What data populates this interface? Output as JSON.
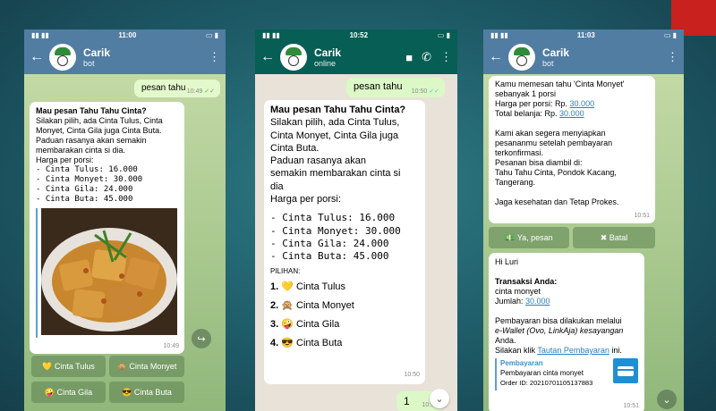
{
  "colors": {
    "telegram_header": "#517da2",
    "whatsapp_header": "#075e54",
    "outgoing_bubble": "#e3f9cc",
    "red_corner": "#c8211e"
  },
  "phone1": {
    "status_time": "11:00",
    "name": "Carik",
    "sub": "bot",
    "out_text": "pesan tahu",
    "out_time": "10:49",
    "in_title": "Mau pesan Tahu Tahu Cinta?",
    "in_body": [
      "Silakan pilih, ada Cinta Tulus, Cinta",
      "Monyet, Cinta Gila juga Cinta Buta.",
      "Paduan rasanya akan semakin",
      "membarakan cinta si dia.",
      "Harga per porsi:"
    ],
    "prices": [
      "- Cinta Tulus: 16.000",
      "- Cinta Monyet: 30.000",
      "- Cinta Gila: 24.000",
      "- Cinta Buta: 45.000"
    ],
    "in_time": "10:49",
    "buttons": [
      "💛 Cinta Tulus",
      "🙊 Cinta Monyet",
      "🤪 Cinta Gila",
      "😎 Cinta Buta"
    ]
  },
  "phone2": {
    "status_time": "10:52",
    "name": "Carik",
    "sub": "online",
    "out_text": "pesan tahu",
    "out_time": "10:50",
    "in_title": "Mau pesan Tahu Tahu Cinta?",
    "in_body": [
      "Silakan pilih, ada Cinta Tulus,",
      "Cinta Monyet, Cinta Gila juga",
      "Cinta Buta.",
      "Paduan rasanya akan",
      "semakin membarakan cinta si",
      "dia",
      "Harga per porsi:"
    ],
    "prices": [
      "- Cinta Tulus: 16.000",
      "- Cinta Monyet: 30.000",
      "- Cinta Gila: 24.000",
      "- Cinta Buta: 45.000"
    ],
    "pilihan_label": "PILIHAN:",
    "options": [
      {
        "num": "1.",
        "emoji": "💛",
        "label": "Cinta Tulus"
      },
      {
        "num": "2.",
        "emoji": "🙊",
        "label": "Cinta Monyet"
      },
      {
        "num": "3.",
        "emoji": "🤪",
        "label": "Cinta Gila"
      },
      {
        "num": "4.",
        "emoji": "😎",
        "label": "Cinta Buta"
      }
    ],
    "in_time": "10:50",
    "reply_text": "1",
    "reply_time": "10:51"
  },
  "phone3": {
    "status_time": "11:03",
    "name": "Carik",
    "sub": "bot",
    "msg1_lines": [
      "Kamu memesan tahu 'Cinta Monyet'",
      "sebanyak 1 porsi"
    ],
    "harga_label": "Harga per porsi: Rp. ",
    "harga_value": "30.000",
    "total_label": "Total belanja: Rp. ",
    "total_value": "30.000",
    "msg1_body": [
      "Kami akan segera menyiapkan",
      "pesananmu setelah pembayaran",
      "terkonfirmasi.",
      "Pesanan bisa diambil di:",
      "Tahu Tahu Cinta, Pondok Kacang,",
      "Tangerang."
    ],
    "msg1_footer": "Jaga kesehatan dan Tetap Prokes.",
    "msg1_time": "10:51",
    "btn_yes": "💵 Ya, pesan",
    "btn_no": "✖ Batal",
    "msg2_greet": "Hi Luri",
    "trans_label": "Transaksi Anda:",
    "trans_item": "cinta monyet",
    "jumlah_label": "Jumlah: ",
    "jumlah_value": "30.000",
    "pay_lines": [
      "Pembayaran bisa dilakukan melalui",
      "e-Wallet (Ovo, LinkAja) kesayangan",
      "Anda."
    ],
    "click_label": "Silakan klik ",
    "click_link": "Tautan Pembayaran",
    "click_end": " ini.",
    "preview_title": "Pembayaran",
    "preview_desc": "Pembayaran cinta monyet",
    "preview_order": "Order ID: 20210701105137883",
    "msg2_time": "10:51"
  }
}
